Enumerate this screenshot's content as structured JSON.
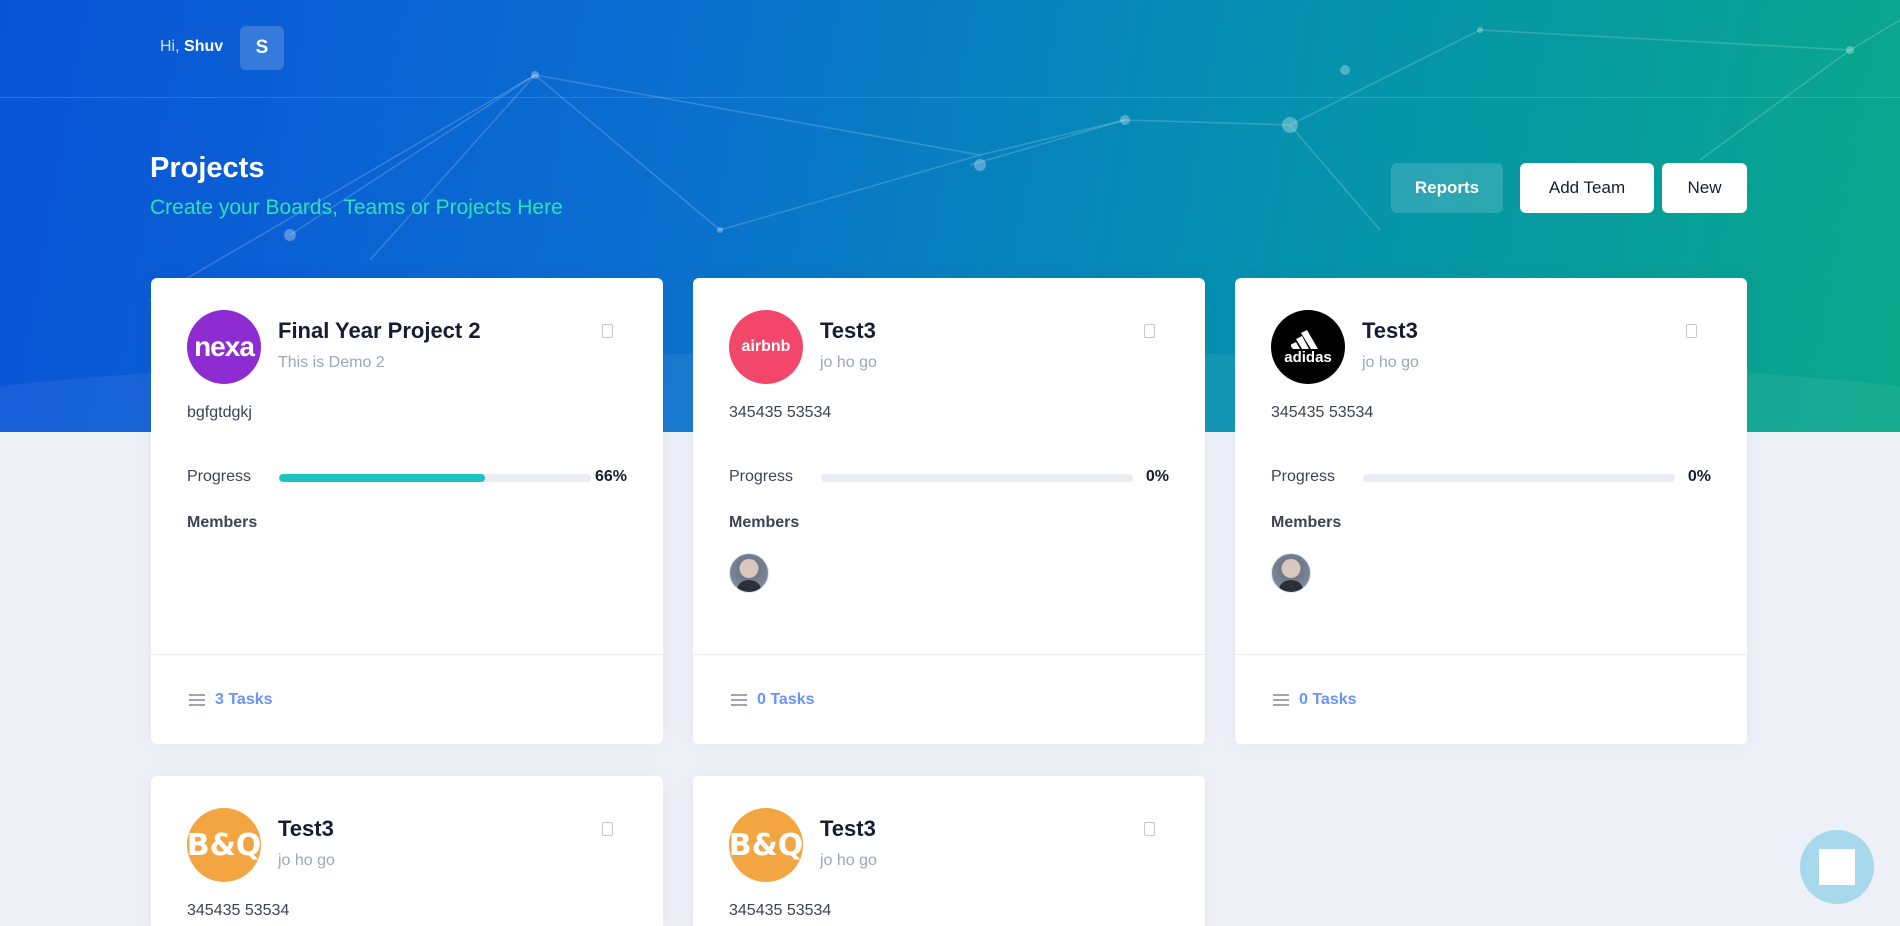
{
  "header": {
    "greeting_prefix": "Hi,",
    "user_name": "Shuv",
    "avatar_initial": "S"
  },
  "page": {
    "title": "Projects",
    "subtitle": "Create your Boards, Teams or Projects Here"
  },
  "toolbar": {
    "reports_label": "Reports",
    "add_team_label": "Add Team",
    "new_label": "New"
  },
  "cards": [
    {
      "logo_text": "nexa",
      "logo_color": "#8d2cd0",
      "title": "Final Year Project 2",
      "subtitle": "This is Demo 2",
      "description": "bgfgtdgkj",
      "progress_label": "Progress",
      "progress": 66,
      "progress_text": "66%",
      "members_label": "Members",
      "members": [],
      "tasks_label": "3 Tasks"
    },
    {
      "logo_text": "airbnb",
      "logo_color": "#f2476b",
      "title": "Test3",
      "subtitle": "jo ho go",
      "description": "345435 53534",
      "progress_label": "Progress",
      "progress": 0,
      "progress_text": "0%",
      "members_label": "Members",
      "members": [
        "member-avatar"
      ],
      "tasks_label": "0 Tasks"
    },
    {
      "logo_text": "adidas",
      "logo_color": "#000000",
      "title": "Test3",
      "subtitle": "jo ho go",
      "description": "345435 53534",
      "progress_label": "Progress",
      "progress": 0,
      "progress_text": "0%",
      "members_label": "Members",
      "members": [
        "member-avatar"
      ],
      "tasks_label": "0 Tasks"
    },
    {
      "logo_text": "B&Q",
      "logo_color": "#f2a540",
      "title": "Test3",
      "subtitle": "jo ho go",
      "description": "345435 53534"
    },
    {
      "logo_text": "B&Q",
      "logo_color": "#f2a540",
      "title": "Test3",
      "subtitle": "jo ho go",
      "description": "345435 53534"
    }
  ],
  "icons": [
    "bookmark-icon",
    "tasks-list-icon",
    "chat-icon"
  ],
  "colors": {
    "accent_teal": "#1bc5bd",
    "link_blue": "#6993ff",
    "subtitle_green": "#2ee0b8"
  }
}
